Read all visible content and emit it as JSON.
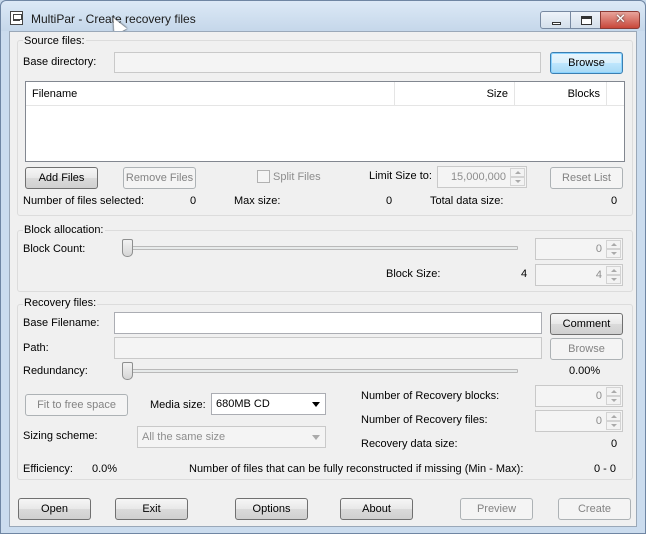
{
  "window": {
    "title": "MultiPar - Create recovery files"
  },
  "source": {
    "group_label": "Source files:",
    "base_dir_label": "Base directory:",
    "base_dir_value": "",
    "browse_label": "Browse",
    "columns": [
      "Filename",
      "Size",
      "Blocks"
    ],
    "add_files_label": "Add Files",
    "remove_files_label": "Remove Files",
    "split_files_label": "Split Files",
    "limit_size_label": "Limit Size to:",
    "limit_size_value": "15,000,000",
    "reset_list_label": "Reset List",
    "num_files_label": "Number of files selected:",
    "num_files_value": "0",
    "max_size_label": "Max size:",
    "max_size_value": "0",
    "total_size_label": "Total data size:",
    "total_size_value": "0"
  },
  "block": {
    "group_label": "Block allocation:",
    "count_label": "Block Count:",
    "count_value": "0",
    "size_label": "Block Size:",
    "size_text": "4",
    "size_value": "4",
    "slider_level": 0
  },
  "recovery": {
    "group_label": "Recovery files:",
    "base_filename_label": "Base Filename:",
    "base_filename_value": "",
    "comment_label": "Comment",
    "path_label": "Path:",
    "path_value": "",
    "path_browse_label": "Browse",
    "redundancy_label": "Redundancy:",
    "redundancy_value": "0.00%",
    "redundancy_level": 0,
    "fit_label": "Fit to free space",
    "media_size_label": "Media size:",
    "media_size_value": "680MB CD",
    "num_blocks_label": "Number of Recovery blocks:",
    "num_blocks_value": "0",
    "num_files_label": "Number of Recovery files:",
    "num_files_value": "0",
    "sizing_label": "Sizing scheme:",
    "sizing_value": "All the same size",
    "data_size_label": "Recovery data size:",
    "data_size_value": "0",
    "efficiency_label": "Efficiency:",
    "efficiency_value": "0.0%",
    "reconstruct_label": "Number of files that can be fully reconstructed if missing (Min - Max):",
    "reconstruct_value": "0 - 0"
  },
  "footer": {
    "open_label": "Open",
    "exit_label": "Exit",
    "options_label": "Options",
    "about_label": "About",
    "preview_label": "Preview",
    "create_label": "Create"
  }
}
